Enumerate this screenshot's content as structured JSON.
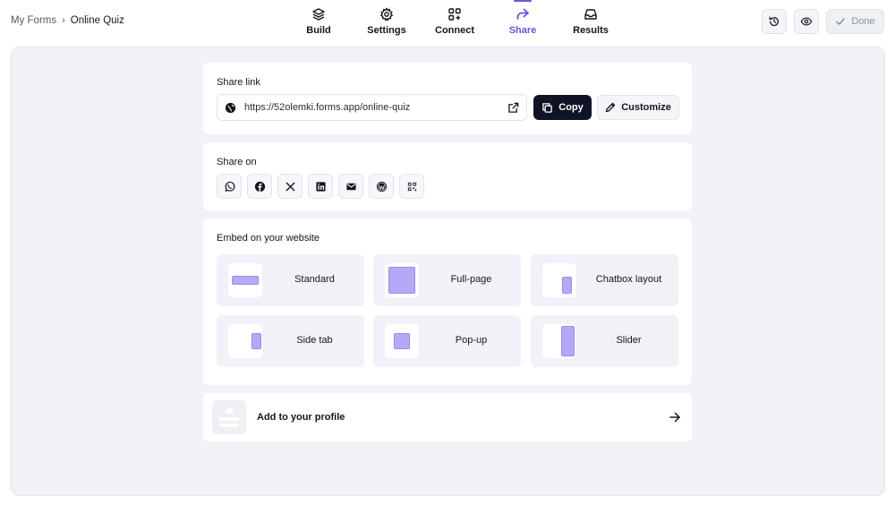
{
  "breadcrumb": {
    "root": "My Forms",
    "separator": "›",
    "current": "Online Quiz"
  },
  "nav": {
    "items": [
      {
        "label": "Build",
        "icon": "layers-icon",
        "active": false
      },
      {
        "label": "Settings",
        "icon": "gear-icon",
        "active": false
      },
      {
        "label": "Connect",
        "icon": "apps-plus-icon",
        "active": false
      },
      {
        "label": "Share",
        "icon": "share-arrow-icon",
        "active": true
      },
      {
        "label": "Results",
        "icon": "inbox-icon",
        "active": false
      }
    ],
    "active_color": "#6a55d8"
  },
  "toolbar": {
    "history_icon": "history-icon",
    "preview_icon": "eye-icon",
    "done_label": "Done"
  },
  "share_link": {
    "title": "Share link",
    "url": "https://52olemki.forms.app/online-quiz",
    "copy_label": "Copy",
    "customize_label": "Customize"
  },
  "share_on": {
    "title": "Share on",
    "platforms": [
      "whatsapp-icon",
      "facebook-icon",
      "x-icon",
      "linkedin-icon",
      "email-icon",
      "wordpress-icon",
      "qr-code-icon"
    ]
  },
  "embed": {
    "title": "Embed on your website",
    "options": [
      "Standard",
      "Full-page",
      "Chatbox layout",
      "Side tab",
      "Pop-up",
      "Slider"
    ],
    "thumb_color": "#b6a8f7"
  },
  "profile": {
    "label": "Add to your profile"
  }
}
